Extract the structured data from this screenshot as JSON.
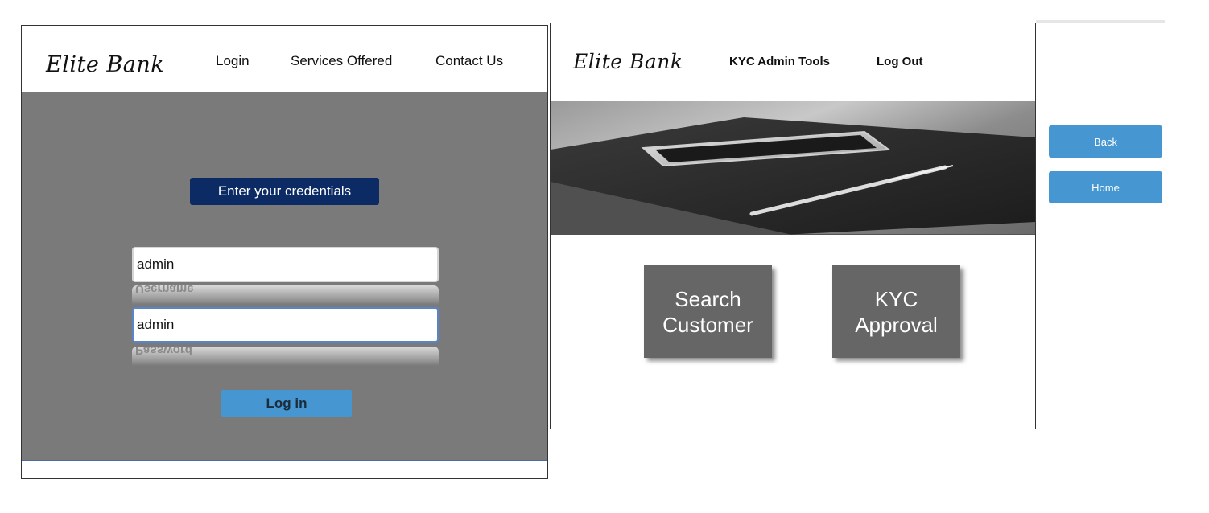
{
  "login_page": {
    "brand": "Elite Bank",
    "nav": [
      "Login",
      "Services Offered",
      "Contact Us"
    ],
    "banner": "Enter your credentials",
    "username": {
      "value": "admin",
      "reflection": "Username"
    },
    "password": {
      "value": "admin",
      "reflection": "Password"
    },
    "login_button": "Log in"
  },
  "admin_page": {
    "brand": "Elite Bank",
    "nav": [
      "KYC Admin Tools",
      "Log Out"
    ],
    "hero_image": "phone-notebook-pen-photo",
    "tiles": [
      "Search\nCustomer",
      "KYC\nApproval"
    ]
  },
  "side_buttons": {
    "back": "Back",
    "home": "Home"
  },
  "colors": {
    "banner_bg": "#0c2a63",
    "button_blue": "#4596d1",
    "panel_gray": "#7a7a7a",
    "tile_gray": "#666666"
  }
}
